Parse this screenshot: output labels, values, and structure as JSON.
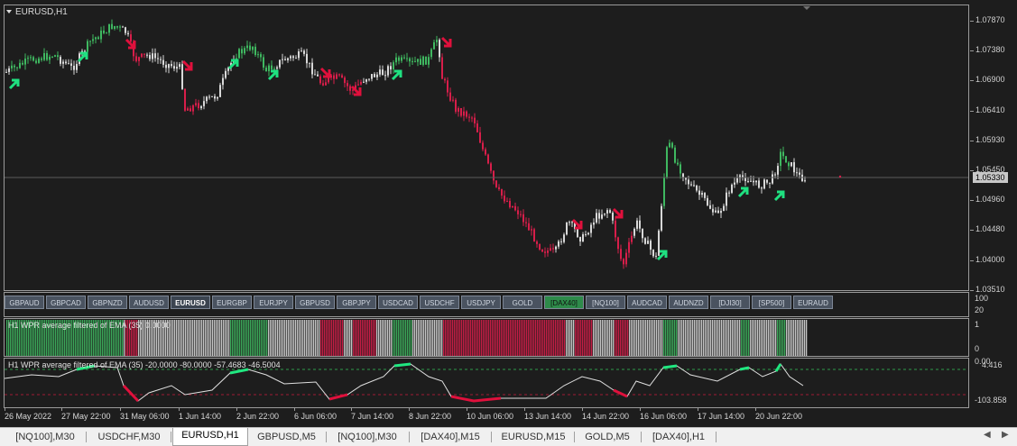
{
  "chart": {
    "title": "EURUSD,H1",
    "current_price": "1.05330",
    "price_labels": [
      "1.07870",
      "1.07380",
      "1.06900",
      "1.06410",
      "1.05930",
      "1.05450",
      "1.04960",
      "1.04480",
      "1.04000",
      "1.03510"
    ]
  },
  "symbol_buttons": [
    "GBPAUD",
    "GBPCAD",
    "GBPNZD",
    "AUDUSD",
    "EURUSD",
    "EURGBP",
    "EURJPY",
    "GBPUSD",
    "GBPJPY",
    "USDCAD",
    "USDCHF",
    "USDJPY",
    "GOLD",
    "[DAX40]",
    "[NQ100]",
    "AUDCAD",
    "AUDNZD",
    "[DJI30]",
    "[SP500]",
    "EURAUD"
  ],
  "active_symbol": "EURUSD",
  "highlighted_symbol": "[DAX40]",
  "pane2_scale": [
    "100",
    "20"
  ],
  "histogram": {
    "label": "H1  WPR average filtered of EMA (35) 0.0000",
    "scale": [
      "1",
      "0"
    ]
  },
  "oscillator": {
    "label": "H1  WPR average filtered of EMA (35) -20.0000 -80.0000 -57.4683 -46.5004",
    "scale": [
      "0.00",
      "4.416",
      "-103.858"
    ]
  },
  "time_labels": [
    "26 May 2022",
    "27 May 22:00",
    "31 May 06:00",
    "1 Jun 14:00",
    "2 Jun 22:00",
    "6 Jun 06:00",
    "7 Jun 14:00",
    "8 Jun 22:00",
    "10 Jun 06:00",
    "13 Jun 14:00",
    "14 Jun 22:00",
    "16 Jun 06:00",
    "17 Jun 14:00",
    "20 Jun 22:00"
  ],
  "tabs": [
    "[NQ100],M30",
    "USDCHF,M30",
    "EURUSD,H1",
    "GBPUSD,M5",
    "[NQ100],M30",
    "[DAX40],M15",
    "EURUSD,M15",
    "GOLD,M5",
    "[DAX40],H1"
  ],
  "active_tab": "EURUSD,H1",
  "colors": {
    "bull": "#3fb860",
    "bear": "#d81e4a",
    "neutral": "#d8d8d8",
    "arrow_up": "#1fe080",
    "arrow_down": "#e0103c",
    "background": "#1d1d1d"
  }
}
